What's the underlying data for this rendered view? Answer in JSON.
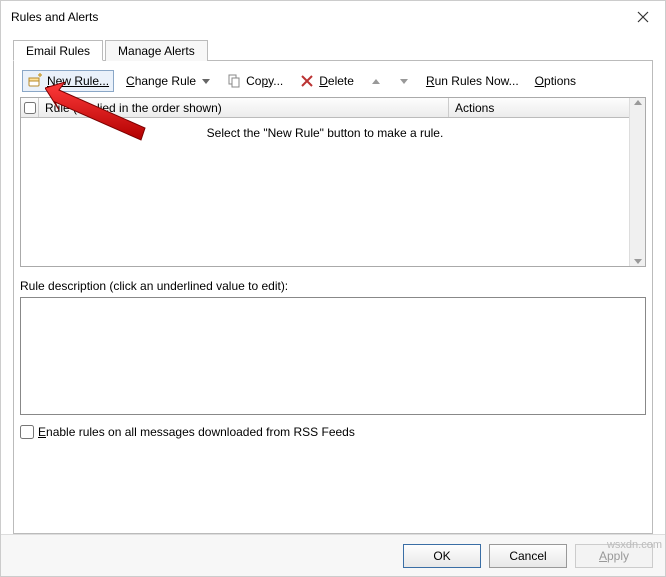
{
  "window": {
    "title": "Rules and Alerts"
  },
  "tabs": {
    "email_rules": "Email Rules",
    "manage_alerts": "Manage Alerts"
  },
  "toolbar": {
    "new_rule": "New Rule...",
    "change_rule": "Change Rule",
    "copy": "Copy...",
    "delete": "Delete",
    "run_rules_now": "Run Rules Now...",
    "options": "Options"
  },
  "grid": {
    "col_rule": "Rule (applied in the order shown)",
    "col_actions": "Actions",
    "empty_text": "Select the \"New Rule\" button to make a rule."
  },
  "description_label": "Rule description (click an underlined value to edit):",
  "rss_checkbox_label_pre": "E",
  "rss_checkbox_label_post": "nable rules on all messages downloaded from RSS Feeds",
  "buttons": {
    "ok": "OK",
    "cancel": "Cancel",
    "apply": "Apply"
  },
  "watermark": "wsxdn.com"
}
